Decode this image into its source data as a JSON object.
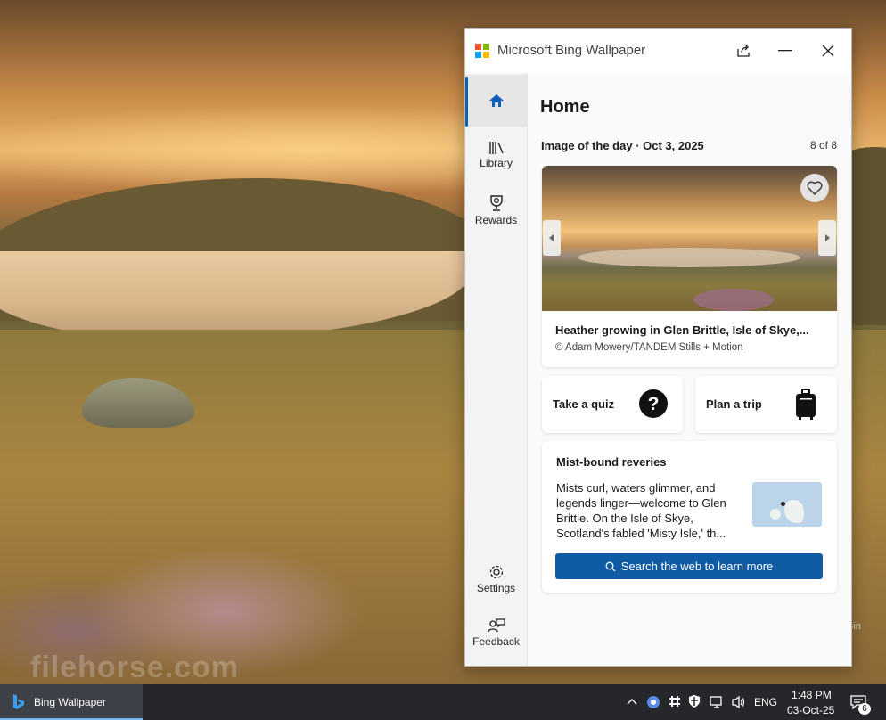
{
  "window": {
    "title": "Microsoft Bing Wallpaper",
    "logo_colors": [
      "#f25022",
      "#7fba00",
      "#00a4ef",
      "#ffb900"
    ],
    "accent": "#0f5ba4"
  },
  "sidebar": {
    "items": [
      {
        "label": "",
        "icon": "home-icon",
        "active": true
      },
      {
        "label": "Library",
        "icon": "library-icon",
        "active": false
      },
      {
        "label": "Rewards",
        "icon": "trophy-icon",
        "active": false
      },
      {
        "label": "Settings",
        "icon": "gear-icon",
        "active": false
      },
      {
        "label": "Feedback",
        "icon": "feedback-icon",
        "active": false
      }
    ]
  },
  "home": {
    "title": "Home",
    "iotd_label": "Image of the day · Oct 3, 2025",
    "count": "8 of 8",
    "image_caption": "Heather growing in Glen Brittle, Isle of Skye,...",
    "image_credit": "© Adam Mowery/TANDEM Stills + Motion"
  },
  "actions": {
    "quiz_label": "Take a quiz",
    "trip_label": "Plan a trip"
  },
  "fact": {
    "title": "Mist-bound reveries",
    "body": "Mists curl, waters glimmer, and legends linger—welcome to Glen Brittle. On the Isle of Skye, Scotland's fabled 'Misty Isle,' th...",
    "search_label": "Search the web to learn more"
  },
  "desktop": {
    "watermark": "filehorse.com",
    "corner_text": "Bin"
  },
  "taskbar": {
    "app_label": "Bing Wallpaper",
    "language": "ENG",
    "time": "1:48 PM",
    "date": "03-Oct-25",
    "notification_count": "6"
  }
}
